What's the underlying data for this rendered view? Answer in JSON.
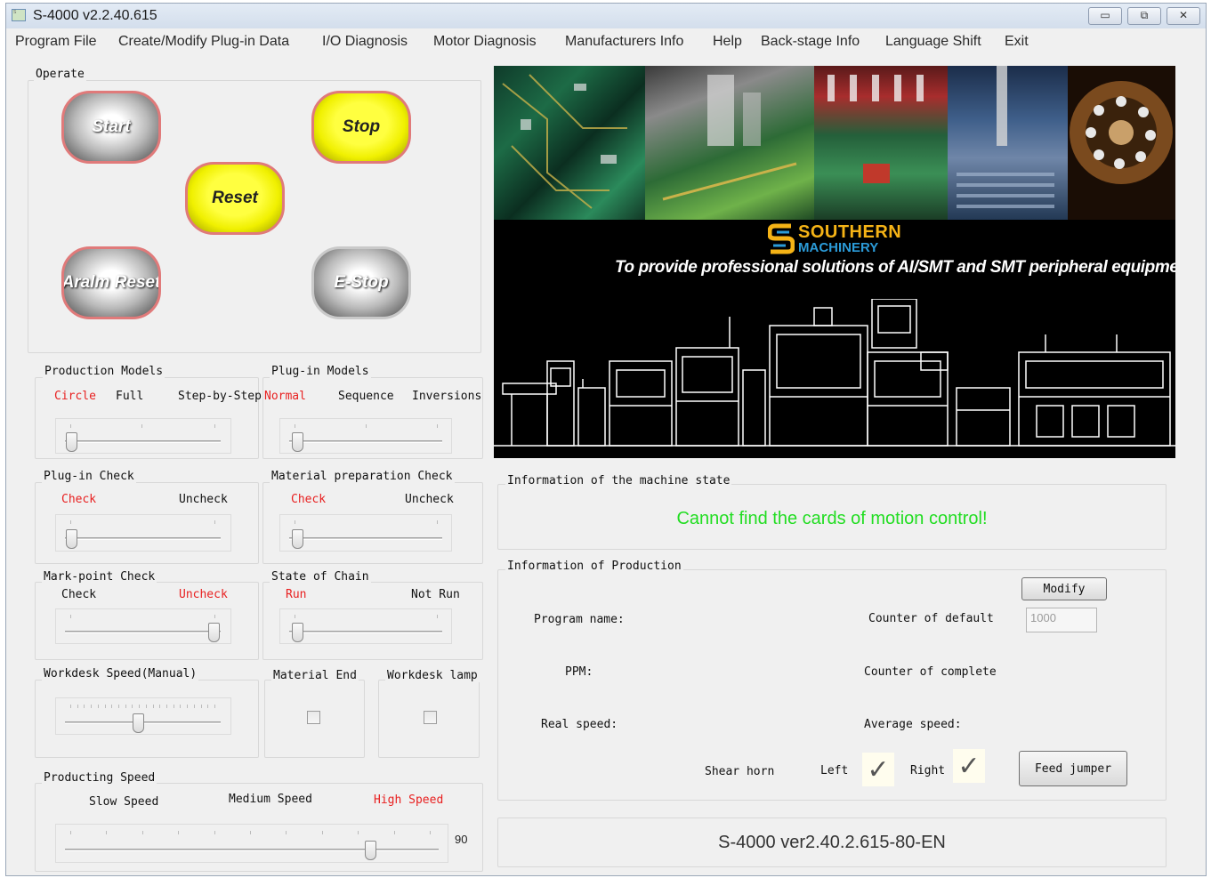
{
  "window": {
    "title": "S-4000 v2.2.40.615",
    "app_icon": "app-logo-icon",
    "controls": {
      "minimize": "▭",
      "maximize": "⧉",
      "close": "✕"
    }
  },
  "menu": [
    "Program File",
    "Create/Modify Plug-in Data",
    "I/O Diagnosis",
    "Motor Diagnosis",
    "Manufacturers Info",
    "Help",
    "Back-stage Info",
    "Language Shift",
    "Exit"
  ],
  "operate": {
    "label": "Operate",
    "buttons": {
      "start": "Start",
      "stop": "Stop",
      "reset": "Reset",
      "alarm_reset": "Aralm Reset",
      "estop": "E-Stop"
    }
  },
  "production_models": {
    "label": "Production Models",
    "options": [
      "Circle",
      "Full",
      "Step-by-Step"
    ],
    "selected": "Circle",
    "level": 0
  },
  "plugin_models": {
    "label": "Plug-in Models",
    "options": [
      "Normal",
      "Sequence",
      "Inversions"
    ],
    "selected": "Normal",
    "level": 0
  },
  "plugin_check": {
    "label": "Plug-in Check",
    "options": [
      "Check",
      "Uncheck"
    ],
    "selected": "Check",
    "level": 0
  },
  "material_prep_check": {
    "label": "Material preparation Check",
    "options": [
      "Check",
      "Uncheck"
    ],
    "selected": "Check",
    "level": 0
  },
  "markpoint_check": {
    "label": "Mark-point Check",
    "options": [
      "Check",
      "Uncheck"
    ],
    "selected": "Uncheck",
    "level": 1
  },
  "state_of_chain": {
    "label": "State of Chain",
    "options": [
      "Run",
      "Not Run"
    ],
    "selected": "Run",
    "level": 0
  },
  "workdesk_speed": {
    "label": "Workdesk Speed(Manual)",
    "level": 0.5
  },
  "material_end": {
    "label": "Material End",
    "checked": false
  },
  "workdesk_lamp": {
    "label": "Workdesk lamp",
    "checked": false
  },
  "producting_speed": {
    "label": "Producting Speed",
    "options": [
      "Slow Speed",
      "Medium Speed",
      "High Speed"
    ],
    "selected": "High Speed",
    "value": "90",
    "level": 0.9
  },
  "banner": {
    "brand_line1": "SOUTHERN",
    "brand_line2": "MACHINERY",
    "tagline": "To provide professional solutions of AI/SMT and SMT peripheral equipment"
  },
  "machine_state": {
    "label": "Information of the machine state",
    "message": "Cannot find the cards of motion control!",
    "message_color": "#22dd22"
  },
  "production_info": {
    "label": "Information of Production",
    "modify_button": "Modify",
    "program_name_label": "Program name:",
    "counter_default_label": "Counter of default",
    "counter_default_value": "1000",
    "ppm_label": "PPM:",
    "counter_complete_label": "Counter of complete",
    "real_speed_label": "Real speed:",
    "average_speed_label": "Average speed:",
    "shear_horn_label": "Shear horn",
    "left_label": "Left",
    "right_label": "Right",
    "left_checked": true,
    "right_checked": true,
    "checkmark": "✓",
    "feed_jumper_button": "Feed jumper"
  },
  "version": "S-4000 ver2.40.2.615-80-EN"
}
